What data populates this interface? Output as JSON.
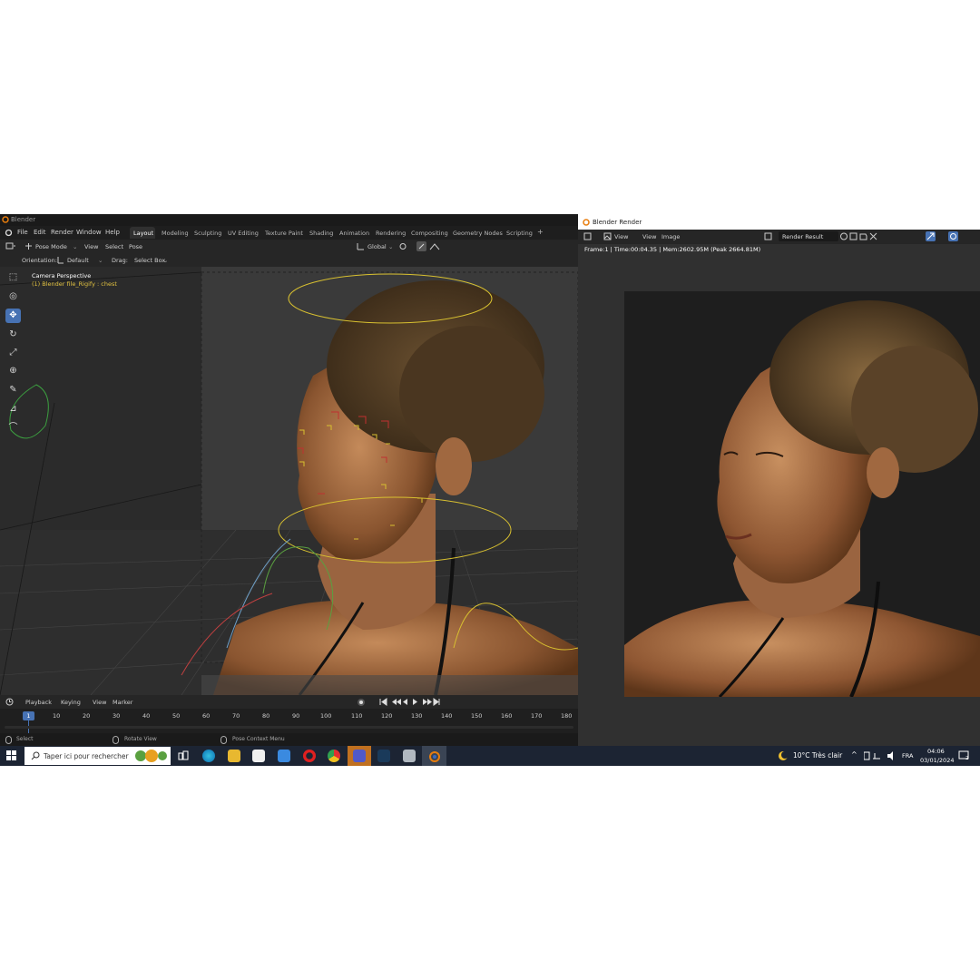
{
  "main_window": {
    "title": "Blender",
    "menu": [
      "File",
      "Edit",
      "Render",
      "Window",
      "Help"
    ],
    "workspaces": [
      "Layout",
      "Modeling",
      "Sculpting",
      "UV Editing",
      "Texture Paint",
      "Shading",
      "Animation",
      "Rendering",
      "Compositing",
      "Geometry Nodes",
      "Scripting",
      "+"
    ],
    "active_workspace": "Layout",
    "header": {
      "mode": "Pose Mode",
      "view": "View",
      "select": "Select",
      "pose": "Pose",
      "transform": "Global"
    },
    "tool_settings": {
      "orientation_label": "Orientation:",
      "orientation_value": "Default",
      "drag_label": "Drag:",
      "drag_value": "Select Box"
    },
    "viewport": {
      "camera_label": "Camera Perspective",
      "object_label": "(1) Blender file_Rigify : chest"
    },
    "timeline": {
      "menu": [
        "Playback",
        "Keying",
        "View",
        "Marker"
      ],
      "current_frame": "1",
      "ticks": [
        "10",
        "20",
        "30",
        "40",
        "50",
        "60",
        "70",
        "80",
        "90",
        "100",
        "110",
        "120",
        "130",
        "140",
        "150",
        "160",
        "170",
        "180"
      ]
    },
    "status": {
      "left": "Select",
      "middle": "Rotate View",
      "right": "Pose Context Menu"
    }
  },
  "render_window": {
    "title": "Blender Render",
    "header": {
      "view": "View",
      "view2": "View",
      "image": "Image",
      "slot": "Render Result"
    },
    "info": "Frame:1 | Time:00:04.35 | Mem:2602.95M (Peak 2664.81M)"
  },
  "taskbar": {
    "search_placeholder": "Taper ici pour rechercher",
    "weather": "10°C  Très clair",
    "language": "FRA",
    "time": "04:06",
    "date": "03/01/2024",
    "notifications": "2"
  },
  "colors": {
    "accent": "#4772b3",
    "rig_yellow": "#e0c040",
    "rig_red": "#c03030",
    "taskbar": "#1c2433"
  }
}
